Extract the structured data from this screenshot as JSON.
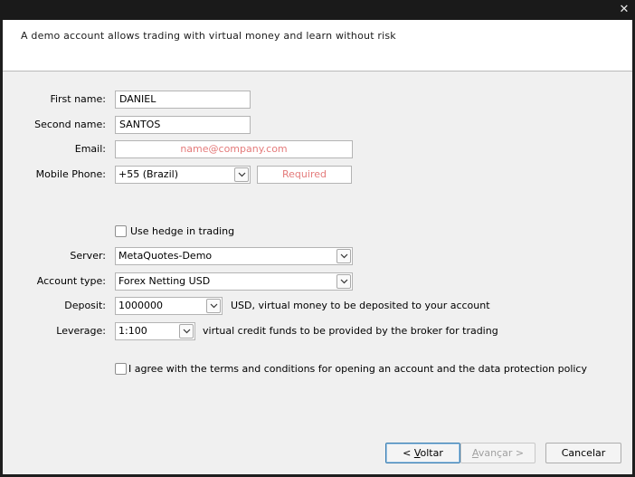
{
  "window": {
    "close_glyph": "✕"
  },
  "header": {
    "text": "A demo account allows trading with virtual money and learn without risk"
  },
  "form": {
    "first_name_label": "First name:",
    "first_name_value": "DANIEL",
    "second_name_label": "Second name:",
    "second_name_value": "SANTOS",
    "email_label": "Email:",
    "email_placeholder": "name@company.com",
    "phone_label": "Mobile Phone:",
    "phone_country": "+55 (Brazil)",
    "phone_placeholder": "Required",
    "hedge_label": "Use hedge in trading",
    "server_label": "Server:",
    "server_value": "MetaQuotes-Demo",
    "account_type_label": "Account type:",
    "account_type_value": "Forex Netting USD",
    "deposit_label": "Deposit:",
    "deposit_value": "1000000",
    "deposit_hint": "USD, virtual money to be deposited to your account",
    "leverage_label": "Leverage:",
    "leverage_value": "1:100",
    "leverage_hint": "virtual credit funds to be provided by the broker for trading",
    "agree_label": "I agree with the terms and conditions for opening an account and the data protection policy"
  },
  "buttons": {
    "back_prefix": "< ",
    "back_accel": "V",
    "back_rest": "oltar",
    "next_accel": "A",
    "next_rest": "vançar >",
    "cancel": "Cancelar"
  }
}
